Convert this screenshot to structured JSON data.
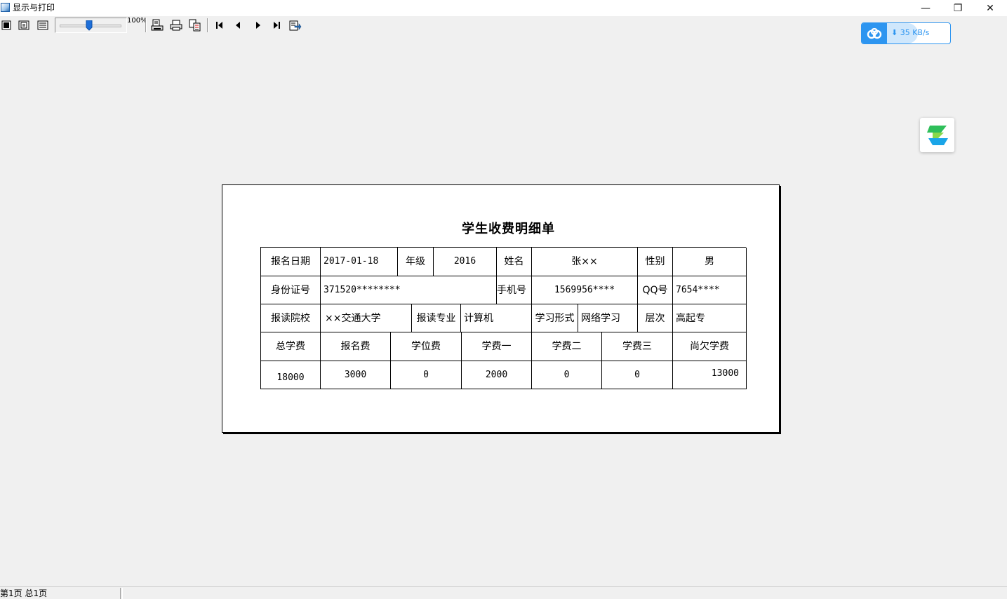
{
  "window": {
    "title": "显示与打印",
    "minimize_glyph": "—",
    "maximize_glyph": "❐",
    "close_glyph": "✕"
  },
  "toolbar": {
    "zoom_label": "100%",
    "zoom_level_percent": 100,
    "icons": [
      "page-view-icon",
      "fit-page-icon",
      "page-width-icon",
      "print-setup-icon",
      "print-icon",
      "export-icon",
      "first-page-icon",
      "prev-page-icon",
      "next-page-icon",
      "last-page-icon",
      "exit-preview-icon"
    ]
  },
  "speed_widget": {
    "text": "35 KB/s",
    "accent": "#2d95f0"
  },
  "report": {
    "title": "学生收费明细单",
    "row1": {
      "signup_date_label": "报名日期",
      "signup_date": "2017-01-18",
      "grade_label": "年级",
      "grade": "2016",
      "name_label": "姓名",
      "name": "张××",
      "gender_label": "性别",
      "gender": "男"
    },
    "row2": {
      "id_label": "身份证号",
      "id": "371520********",
      "phone_label": "手机号",
      "phone": "1569956****",
      "qq_label": "QQ号",
      "qq": "7654****"
    },
    "row3": {
      "school_label": "报读院校",
      "school": "××交通大学",
      "major_label": "报读专业",
      "major": "计算机",
      "mode_label": "学习形式",
      "mode": "网络学习",
      "level_label": "层次",
      "level": "高起专"
    },
    "fee_headers": [
      "总学费",
      "报名费",
      "学位费",
      "学费一",
      "学费二",
      "学费三",
      "尚欠学费"
    ],
    "fee_values": [
      "18000",
      "3000",
      "0",
      "2000",
      "0",
      "0",
      "13000"
    ]
  },
  "status": {
    "page_info": "第1页 总1页"
  }
}
